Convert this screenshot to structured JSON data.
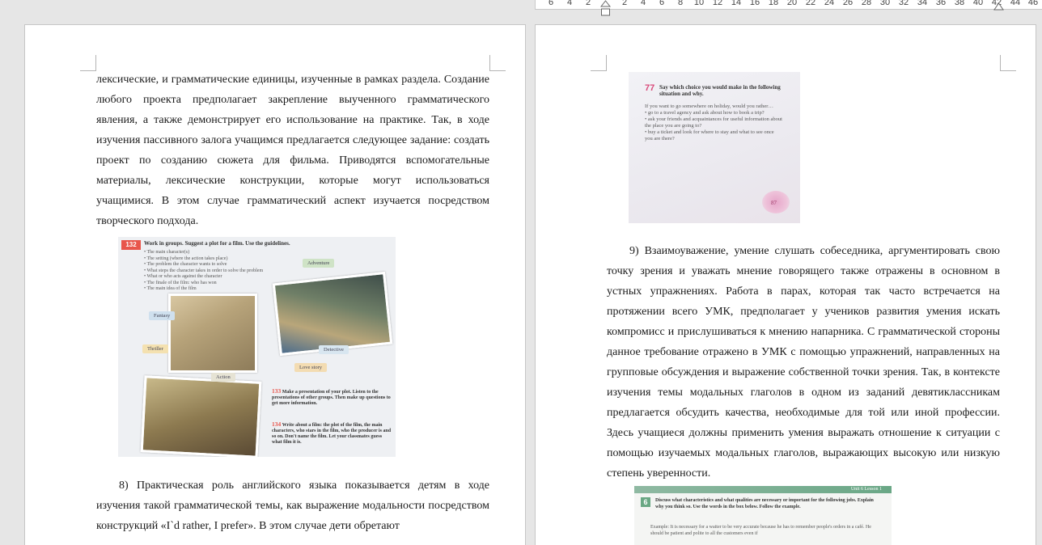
{
  "ruler": {
    "numbers": [
      "6",
      "4",
      "2",
      "2",
      "4",
      "6",
      "8",
      "10",
      "12",
      "14",
      "16",
      "18",
      "20",
      "22",
      "24",
      "26",
      "28",
      "30",
      "32",
      "34",
      "36",
      "38",
      "40",
      "42",
      "44",
      "46"
    ]
  },
  "left_page": {
    "para1": "лексические, и грамматические единицы, изученные в рамках раздела. Создание любого проекта предполагает закрепление выученного грамматического явления, а также демонстрирует его использование на практике. Так, в ходе изучения пассивного залога учащимся предлагается следующее задание: создать проект по созданию сюжета для фильма. Приводятся вспомогательные материалы, лексические конструкции, которые могут использоваться учащимися. В этом случае грамматический аспект изучается посредством творческого подхода.",
    "para2": "8) Практическая роль английского языка показывается детям в ходе изучения такой грамматической темы, как выражение модальности посредством конструкций «I`d rather, I prefer». В этом случае дети обретают",
    "figure132": {
      "number": "132",
      "title": "Work in groups. Suggest a plot for a film. Use the guidelines.",
      "list": [
        "• The main character(s)",
        "• The setting (where the action takes place)",
        "• The problem the character wants to solve",
        "• What steps the character takes in order to solve the problem",
        "• What or who acts against the character",
        "• The finale of the film: who has won",
        "• The main idea of the film"
      ],
      "tags": {
        "adventure": "Adventure",
        "fantasy": "Fantasy",
        "thriller": "Thriller",
        "detective": "Detective",
        "love_story": "Love story",
        "action": "Action"
      },
      "ex133_number": "133",
      "ex133_text": "Make a presentation of your plot. Listen to the presentations of other groups. Then make up questions to get more information.",
      "ex134_number": "134",
      "ex134_text": "Write about a film: the plot of the film, the main characters, who stars in the film, who the producer is and so on. Don't name the film. Let your classmates guess what film it is."
    }
  },
  "right_page": {
    "figure77": {
      "number": "77",
      "title": "Say which choice you would make in the following situation and why.",
      "intro": "If you want to go somewhere on holiday, would you rather…",
      "list": [
        "• go to a travel agency and ask about how to book a trip?",
        "• ask your friends and acquaintances for useful information about the place you are going to?",
        "• buy a ticket and look for where to stay and what to see once you are there?"
      ],
      "page_number": "87"
    },
    "para1": "9) Взаимоуважение, умение слушать собеседника, аргументировать свою точку зрения и уважать мнение говорящего также отражены в основном в устных упражнениях. Работа в парах, которая так часто встречается на протяжении всего УМК, предполагает у учеников развития умения искать компромисс и прислушиваться к мнению напарника. С грамматической стороны данное требование отражено в УМК с помощью упражнений, направленных на групповые обсуждения и выражение собственной точки зрения. Так, в контексте изучения темы модальных глаголов в одном из заданий девятиклассникам предлагается обсудить качества, необходимые для той или иной профессии. Здесь учащиеся должны применить умения выражать отношение к ситуации с помощью изучаемых модальных глаголов, выражающих высокую или низкую степень уверенности.",
    "figure6": {
      "header": "Unit 6 Lesson 1",
      "number": "6",
      "title": "Discuss what characteristics and what qualities are necessary or important for the following jobs. Explain why you think so. Use the words in the box below. Follow the example.",
      "example": "Example: It is necessary for a waiter to be very accurate because he has to remember people's orders in a café. He should be patient and polite to all the customers even if"
    }
  }
}
